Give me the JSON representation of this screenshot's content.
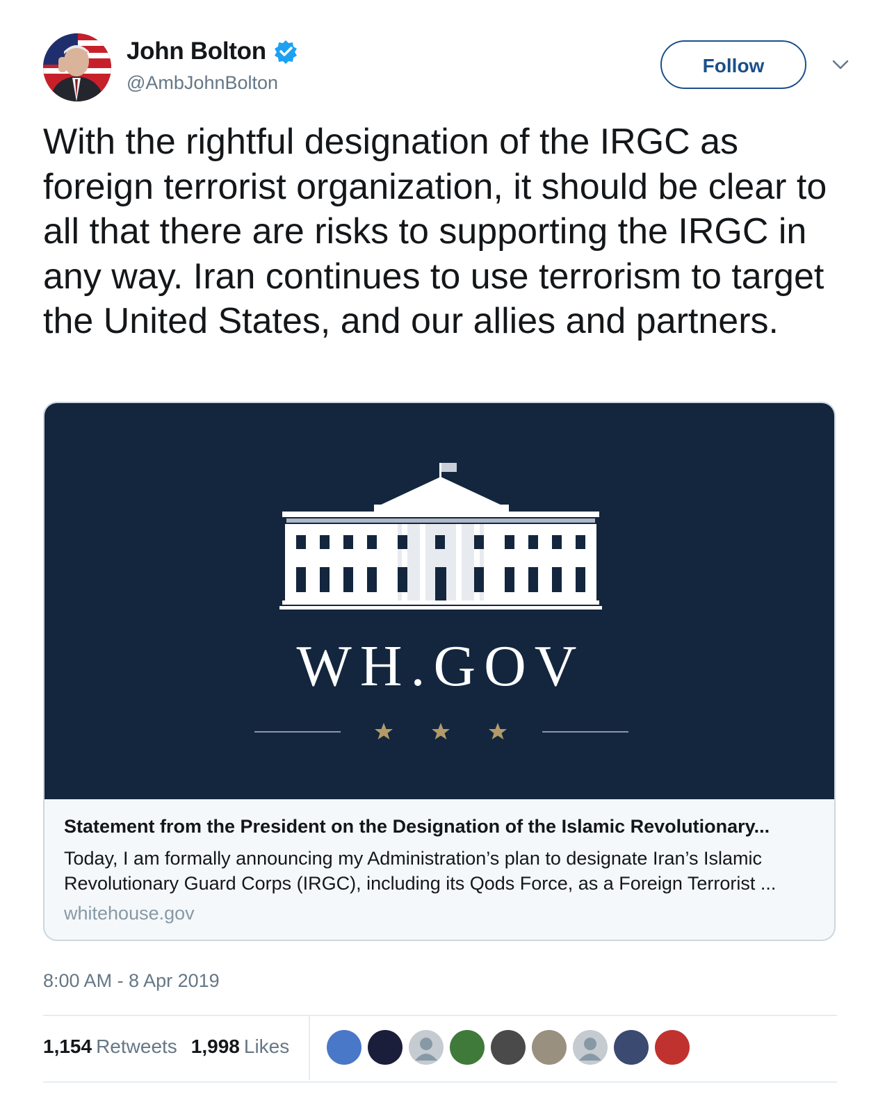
{
  "author": {
    "display_name": "John Bolton",
    "handle": "@AmbJohnBolton",
    "verified": true,
    "follow_label": "Follow"
  },
  "tweet": {
    "text": "With the rightful designation of the IRGC as foreign terrorist organization, it should be clear to all that there are risks to supporting the IRGC in any way. Iran continues to use terrorism to target the United States, and our allies and partners.",
    "timestamp": "8:00 AM - 8 Apr 2019"
  },
  "card": {
    "image_text": "WH.GOV",
    "title": "Statement from the President on the Designation of the Islamic Revolutionary...",
    "description": "Today, I am formally announcing my Administration’s plan to designate Iran’s Islamic Revolutionary Guard Corps (IRGC), including its Qods Force, as a Foreign Terrorist ...",
    "domain": "whitehouse.gov"
  },
  "stats": {
    "retweets_count": "1,154",
    "retweets_label": "Retweets",
    "likes_count": "1,998",
    "likes_label": "Likes"
  },
  "likers": [
    {
      "icon": "liker-avatar",
      "color": "#4a78c8"
    },
    {
      "icon": "liker-avatar",
      "color": "#1a1e3a"
    },
    {
      "icon": "default-avatar",
      "color": "#c5cbd1"
    },
    {
      "icon": "liker-avatar",
      "color": "#3f7a3a"
    },
    {
      "icon": "liker-avatar",
      "color": "#4a4a4a"
    },
    {
      "icon": "liker-avatar",
      "color": "#9a9080"
    },
    {
      "icon": "default-avatar",
      "color": "#c5cbd1"
    },
    {
      "icon": "liker-avatar",
      "color": "#3a4a70"
    },
    {
      "icon": "liker-avatar",
      "color": "#c0322e"
    }
  ],
  "colors": {
    "accent": "#1b4f8a",
    "verified_badge": "#1da1f2",
    "card_image_bg": "#13263e",
    "star_gold": "#b39a68"
  }
}
